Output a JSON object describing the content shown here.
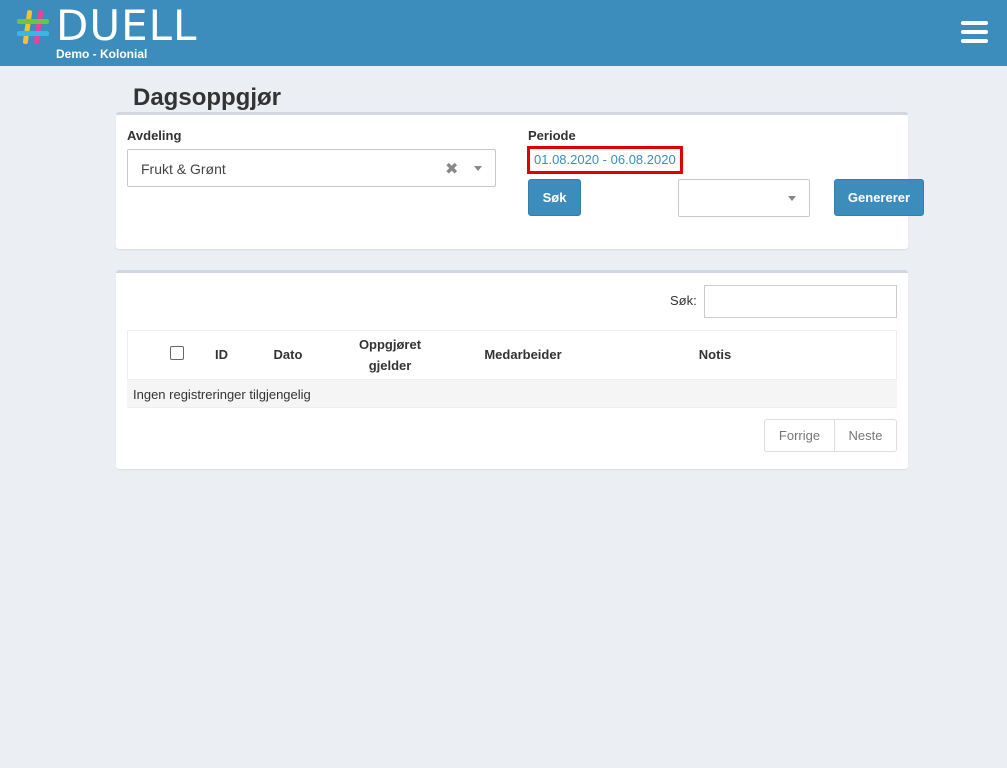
{
  "header": {
    "brand": "DUELL",
    "subtitle": "Demo - Kolonial",
    "menu_icon": "hamburger-menu-icon",
    "color": "#3c8dbc"
  },
  "page": {
    "title": "Dagsoppgjør"
  },
  "filter": {
    "department_label": "Avdeling",
    "department_value": "Frukt & Grønt",
    "clear_icon": "✖",
    "period_label": "Periode",
    "period_value": "01.08.2020 - 06.08.2020",
    "search_button": "Søk",
    "generate_button": "Genererer",
    "extra_select_value": ""
  },
  "table": {
    "search_label": "Søk:",
    "search_value": "",
    "columns": [
      "ID",
      "Dato",
      "Oppgjøret gjelder",
      "Medarbeider",
      "Notis"
    ],
    "column_oppgjoret_line1": "Oppgjøret",
    "column_oppgjoret_line2": "gjelder",
    "empty_message": "Ingen registreringer tilgjengelig",
    "prev": "Forrige",
    "next": "Neste"
  }
}
